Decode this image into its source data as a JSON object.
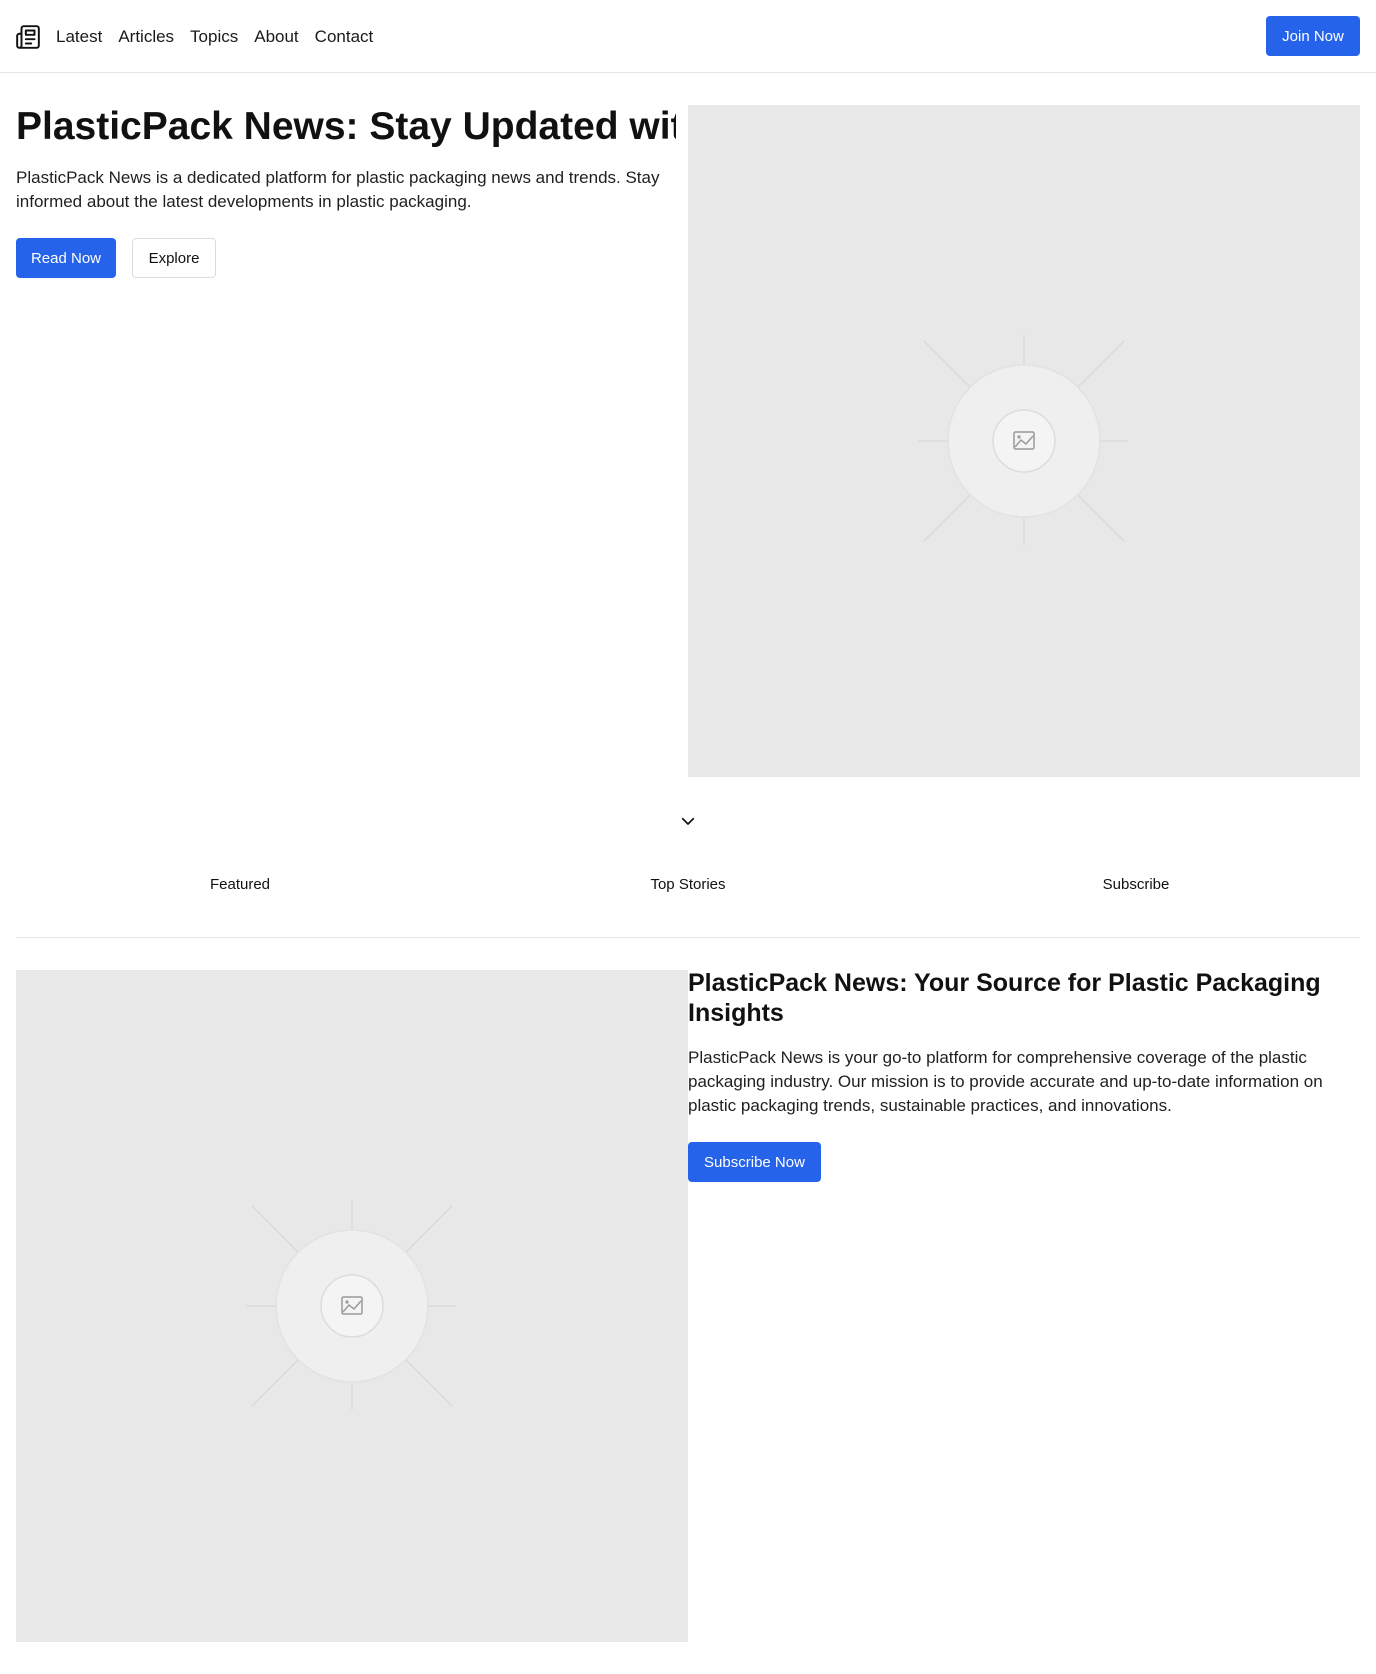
{
  "header": {
    "logo_icon": "newspaper-icon",
    "nav": [
      "Latest",
      "Articles",
      "Topics",
      "About",
      "Contact"
    ],
    "cta_label": "Join Now"
  },
  "hero": {
    "title": "PlasticPack News: Stay Updated with",
    "description": "PlasticPack News is a dedicated platform for plastic packaging news and trends. Stay informed about the latest developments in plastic packaging.",
    "primary_label": "Read Now",
    "secondary_label": "Explore",
    "image_icon": "image-placeholder-icon",
    "scroll_icon": "chevron-down-icon"
  },
  "tabs": [
    "Featured",
    "Top Stories",
    "Subscribe"
  ],
  "section": {
    "title": "PlasticPack News: Your Source for Plastic Packaging Insights",
    "description": "PlasticPack News is your go-to platform for comprehensive coverage of the plastic packaging industry. Our mission is to provide accurate and up-to-date information on plastic packaging trends, sustainable practices, and innovations.",
    "cta_label": "Subscribe Now",
    "image_icon": "image-placeholder-icon"
  },
  "colors": {
    "accent": "#2563eb",
    "placeholder": "#e8e8e8",
    "border": "#e5e5e5"
  }
}
